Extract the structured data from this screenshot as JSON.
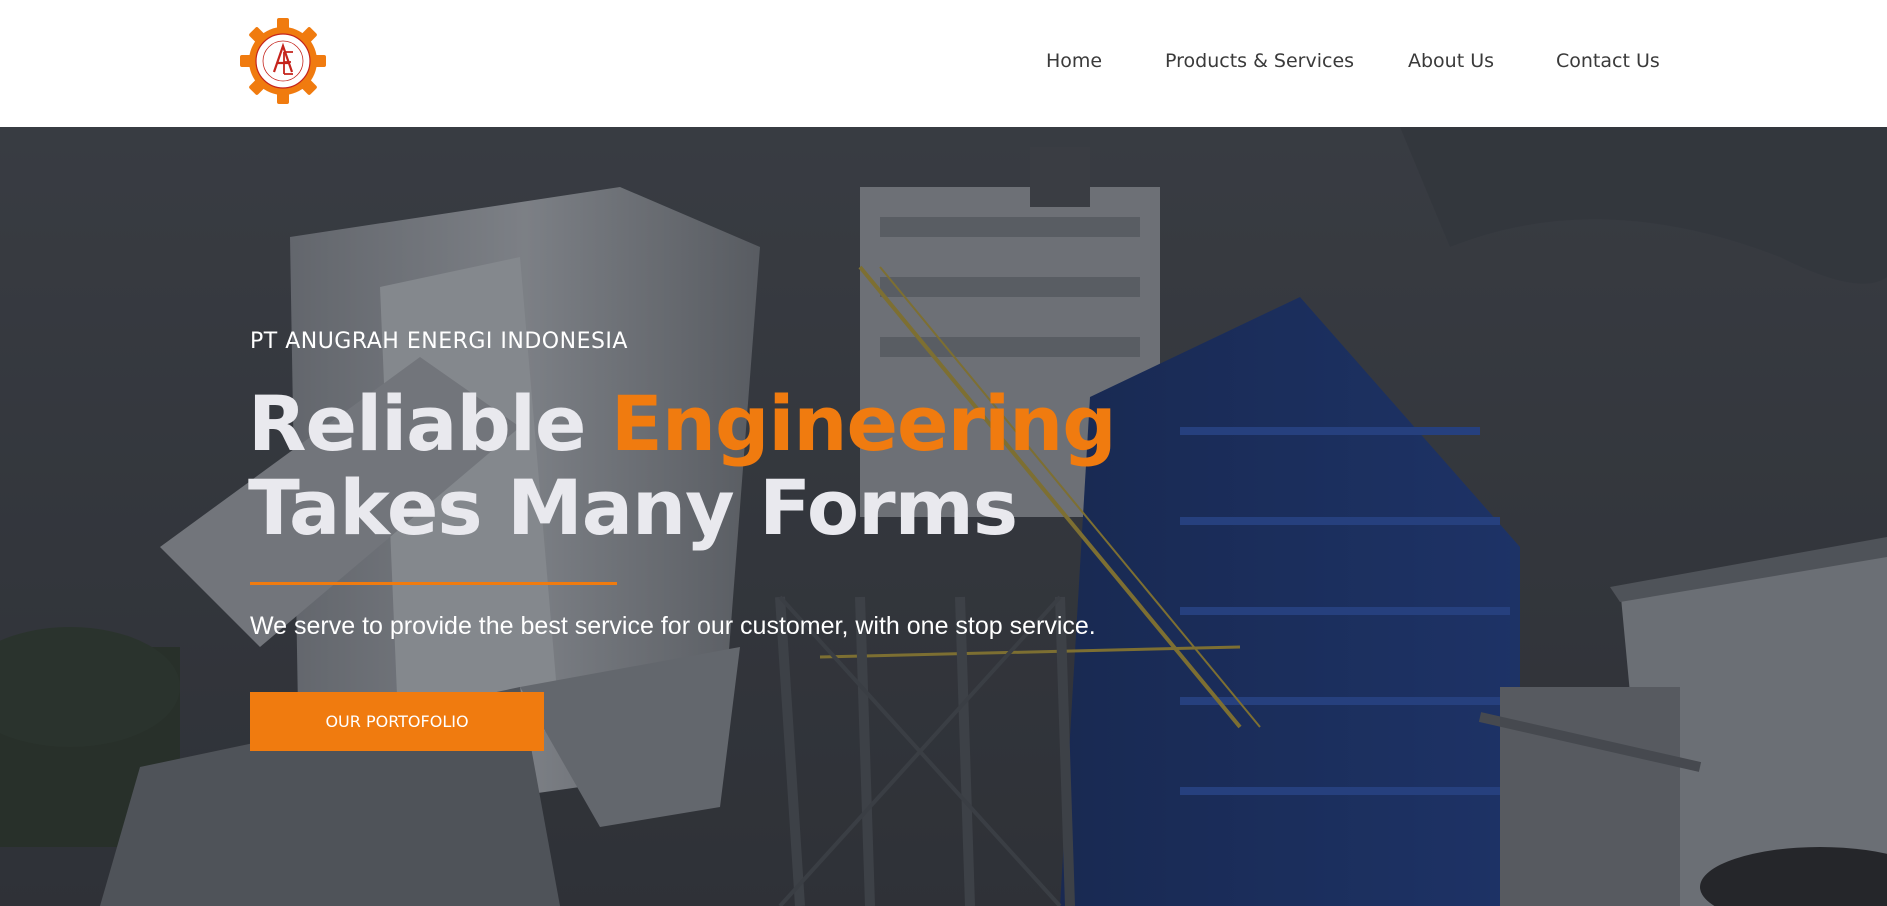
{
  "brand": {
    "logo_icon": "gear-logo-icon",
    "colors": {
      "accent": "#f07b0f",
      "nav_text": "#3a3a3a",
      "headline_text": "#e9e9ee",
      "header_bg": "#ffffff"
    }
  },
  "nav": {
    "items": [
      {
        "label": "Home"
      },
      {
        "label": "Products & Services"
      },
      {
        "label": "About Us"
      },
      {
        "label": "Contact Us"
      }
    ]
  },
  "hero": {
    "eyebrow": "PT ANUGRAH ENERGI INDONESIA",
    "headline_part1": "Reliable ",
    "headline_accent": "Engineering",
    "headline_line2": "Takes Many Forms",
    "subtext": "We serve to provide the best service for our customer, with one stop service.",
    "cta_label": "OUR PORTOFOLIO"
  }
}
